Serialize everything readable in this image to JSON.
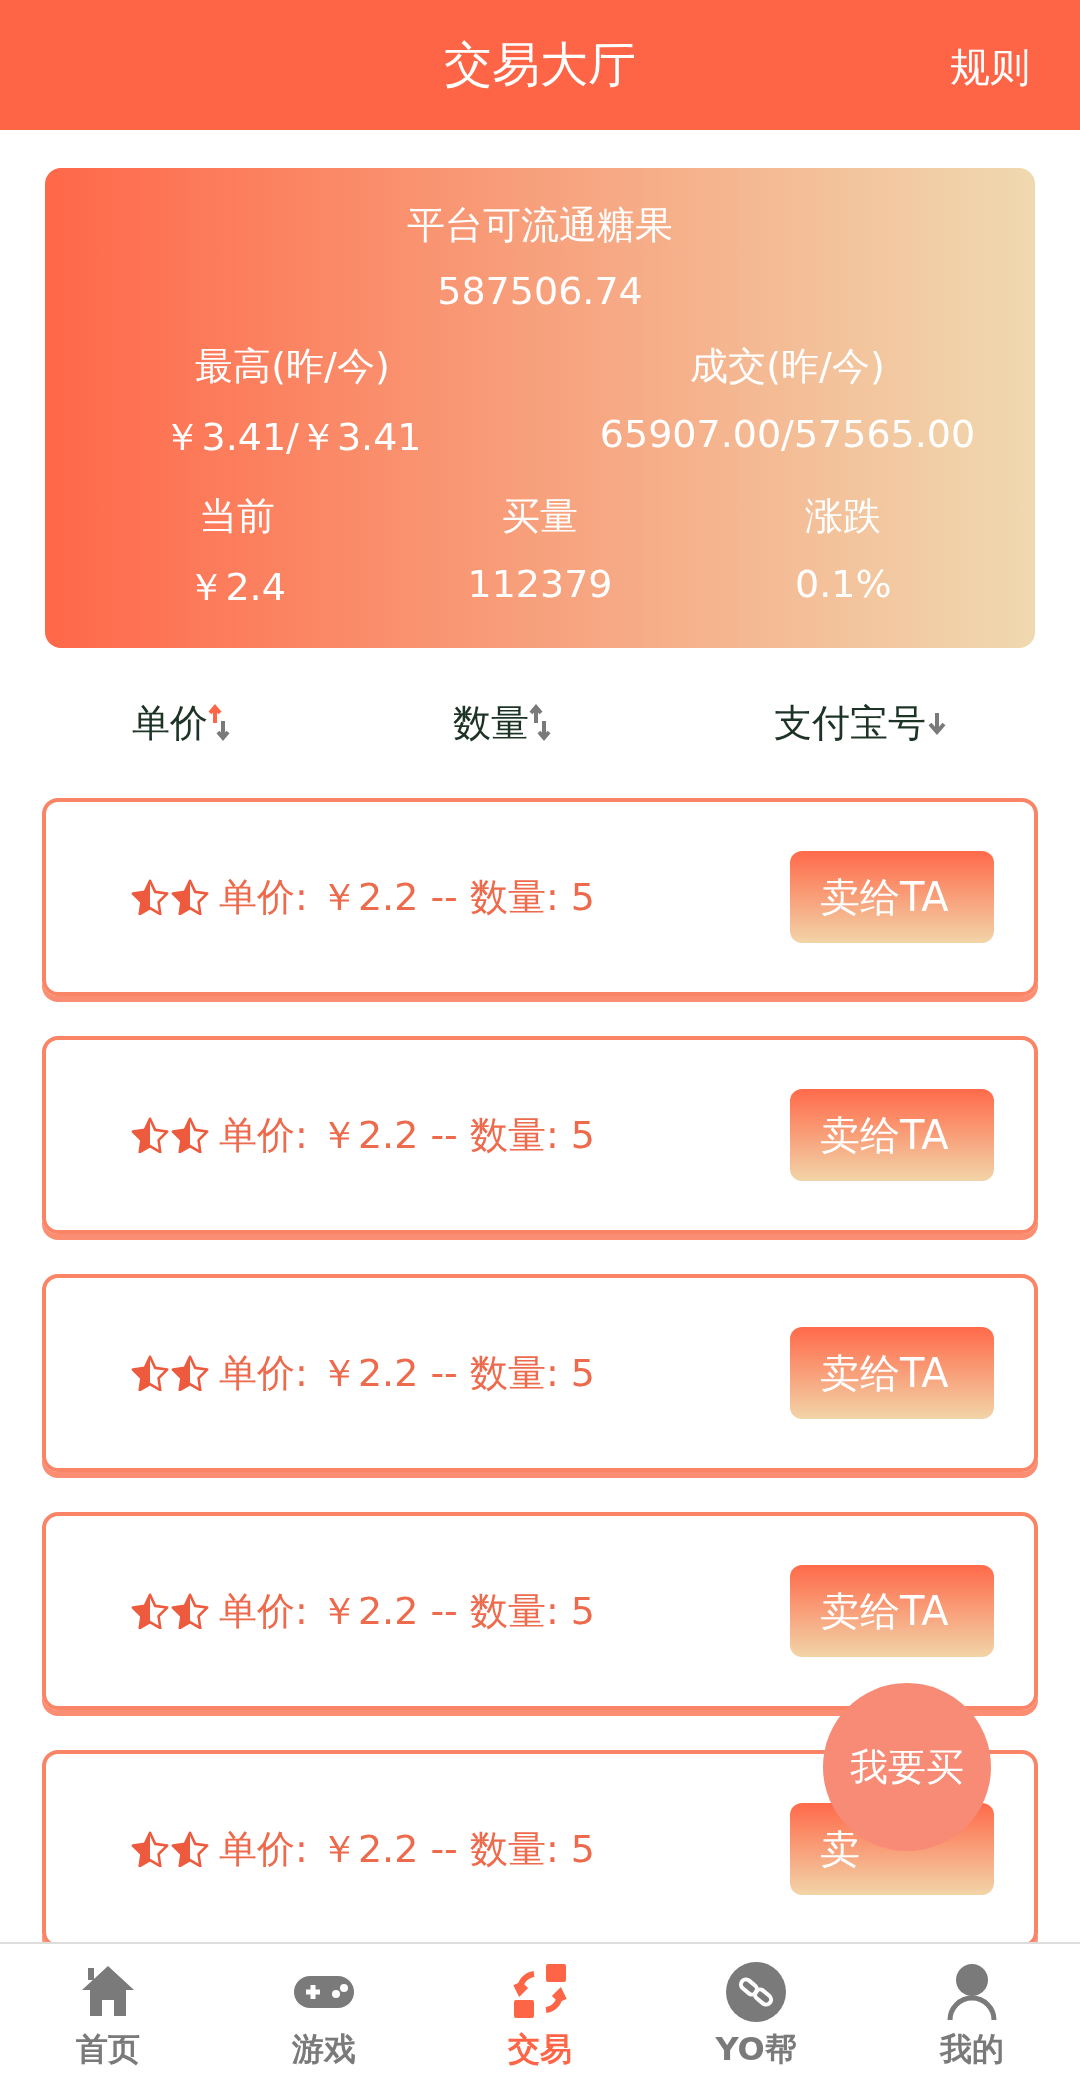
{
  "header": {
    "title": "交易大厅",
    "action": "规则"
  },
  "summary": {
    "title": "平台可流通糖果",
    "total": "587506.74",
    "pairs": [
      {
        "label": "最高(昨/今)",
        "value": "￥3.41/￥3.41"
      },
      {
        "label": "成交(昨/今)",
        "value": "65907.00/57565.00"
      }
    ],
    "stats": [
      {
        "label": "当前",
        "value": "￥2.4"
      },
      {
        "label": "买量",
        "value": "112379"
      },
      {
        "label": "涨跌",
        "value": "0.1%"
      }
    ]
  },
  "sort_columns": [
    {
      "label": "单价",
      "kind": "updown",
      "selected": true
    },
    {
      "label": "数量",
      "kind": "updown",
      "selected": false
    },
    {
      "label": "支付宝号",
      "kind": "down",
      "selected": false
    }
  ],
  "orders": [
    {
      "text": "单价: ￥2.2 -- 数量: 5",
      "button": "卖给TA"
    },
    {
      "text": "单价: ￥2.2 -- 数量: 5",
      "button": "卖给TA"
    },
    {
      "text": "单价: ￥2.2 -- 数量: 5",
      "button": "卖给TA"
    },
    {
      "text": "单价: ￥2.2 -- 数量: 5",
      "button": "卖给TA"
    },
    {
      "text": "单价: ￥2.2 -- 数量: 5",
      "button": "卖"
    }
  ],
  "floating_button": "我要买",
  "nav": [
    {
      "label": "首页",
      "selected": false
    },
    {
      "label": "游戏",
      "selected": false
    },
    {
      "label": "交易",
      "selected": true
    },
    {
      "label": "YO帮",
      "selected": false
    },
    {
      "label": "我的",
      "selected": false
    }
  ]
}
